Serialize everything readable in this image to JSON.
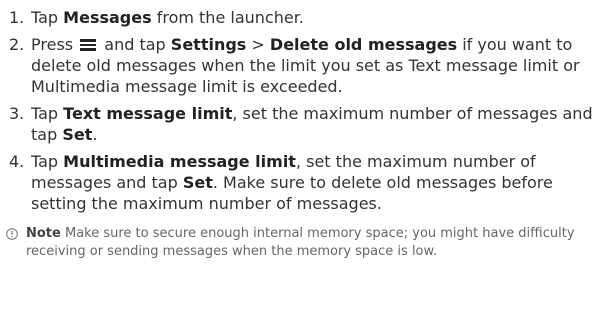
{
  "steps": [
    {
      "num": "1.",
      "parts": [
        "Tap ",
        "Messages",
        " from the launcher."
      ]
    },
    {
      "num": "2.",
      "parts": [
        "Press ",
        " and tap ",
        "Settings",
        " > ",
        "Delete old messages",
        " if you want to delete old messages when the limit you set as Text message limit or Multimedia message limit is exceeded."
      ],
      "icon": "menu-icon"
    },
    {
      "num": "3.",
      "parts": [
        "Tap ",
        "Text message limit",
        ", set the maximum number of messages and tap ",
        "Set",
        "."
      ]
    },
    {
      "num": "4.",
      "parts": [
        "Tap ",
        "Multimedia message limit",
        ", set the maximum number of messages and tap ",
        "Set",
        ". Make sure to delete old messages before setting the maximum number of messages."
      ]
    }
  ],
  "note": {
    "icon": "info-circle-icon",
    "label": "Note",
    "text": " Make sure to secure enough internal memory space; you might have difficulty receiving or sending messages when the memory space is low."
  }
}
